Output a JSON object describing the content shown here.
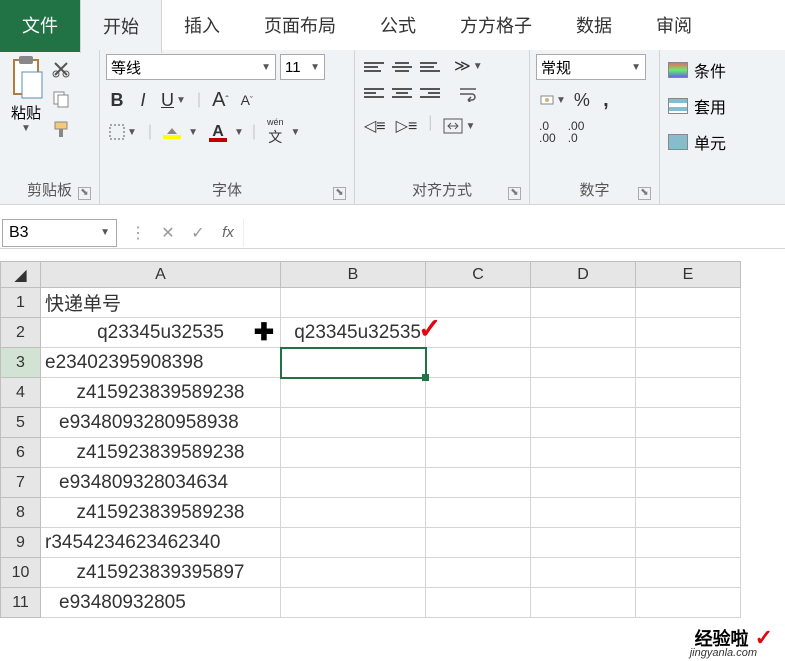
{
  "tabs": {
    "file": "文件",
    "home": "开始",
    "insert": "插入",
    "layout": "页面布局",
    "formula": "公式",
    "ffgz": "方方格子",
    "data": "数据",
    "review": "审阅"
  },
  "clipboard": {
    "paste": "粘贴",
    "label": "剪贴板"
  },
  "font": {
    "name": "等线",
    "size": "11",
    "label": "字体",
    "bold": "B",
    "italic": "I",
    "underline": "U",
    "increase": "A",
    "decrease": "A",
    "pinyin": "wén",
    "pinyinBtn": "文"
  },
  "alignment": {
    "label": "对齐方式"
  },
  "number": {
    "format": "常规",
    "label": "数字"
  },
  "styles": {
    "cond": "条件",
    "table": "套用",
    "cell": "单元"
  },
  "namebox": {
    "value": "B3"
  },
  "headers": {
    "A": "A",
    "B": "B",
    "C": "C",
    "D": "D",
    "E": "E"
  },
  "rows": {
    "1": {
      "A": "快递单号"
    },
    "2": {
      "A": "q23345u32535",
      "B": "q23345u32535"
    },
    "3": {
      "A": "e23402395908398"
    },
    "4": {
      "A": "z415923839589238"
    },
    "5": {
      "A": "e9348093280958938"
    },
    "6": {
      "A": "z415923839589238"
    },
    "7": {
      "A": "e934809328034634"
    },
    "8": {
      "A": "z415923839589238"
    },
    "9": {
      "A": "r3454234623462340"
    },
    "10": {
      "A": "z415923839395897"
    },
    "11": {
      "A": "e93480932805"
    }
  },
  "watermark": {
    "text": "经验啦",
    "sub": "jingyanla.com"
  }
}
